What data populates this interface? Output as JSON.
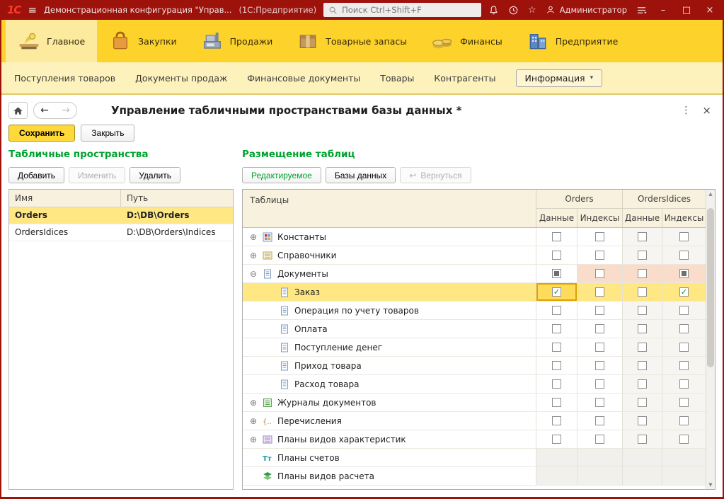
{
  "titlebar": {
    "logo": "1С",
    "title": "Демонстрационная конфигурация \"Управ...",
    "title_suffix": "(1С:Предприятие)",
    "search_placeholder": "Поиск Ctrl+Shift+F",
    "user": "Администратор"
  },
  "icons": {
    "menu": "≡",
    "favorites": "☆",
    "minimize": "–",
    "maximize": "□",
    "close": "×",
    "kebab": "⋮",
    "back": "←",
    "forward": "→",
    "dropdown": "▾",
    "expand": "⊕",
    "collapse": "⊖",
    "check": "✓",
    "return": "↩",
    "scroll_up": "▲",
    "scroll_down": "▼"
  },
  "ribbon": {
    "sections": [
      {
        "label": "Главное",
        "active": true
      },
      {
        "label": "Закупки",
        "active": false
      },
      {
        "label": "Продажи",
        "active": false
      },
      {
        "label": "Товарные запасы",
        "active": false
      },
      {
        "label": "Финансы",
        "active": false
      },
      {
        "label": "Предприятие",
        "active": false
      }
    ]
  },
  "subnav": {
    "links": [
      "Поступления товаров",
      "Документы продаж",
      "Финансовые документы",
      "Товары",
      "Контрагенты"
    ],
    "dropdown": "Информация"
  },
  "page": {
    "title": "Управление табличными пространствами базы данных *",
    "save": "Сохранить",
    "close": "Закрыть"
  },
  "left_panel": {
    "title": "Табличные пространства",
    "buttons": {
      "add": "Добавить",
      "edit": "Изменить",
      "remove": "Удалить"
    },
    "columns": {
      "name": "Имя",
      "path": "Путь"
    },
    "rows": [
      {
        "name": "Orders",
        "path": "D:\\DB\\Orders",
        "selected": true
      },
      {
        "name": "OrdersIdices",
        "path": "D:\\DB\\Orders\\Indices",
        "selected": false
      }
    ]
  },
  "right_panel": {
    "title": "Размещение таблиц",
    "buttons": [
      {
        "label": "Редактируемое",
        "state": "active"
      },
      {
        "label": "Базы данных",
        "state": "normal"
      },
      {
        "label": "Вернуться",
        "state": "disabled"
      }
    ],
    "table": {
      "first_col": "Таблицы",
      "groups": [
        {
          "label": "Orders",
          "cols": [
            "Данные",
            "Индексы"
          ]
        },
        {
          "label": "OrdersIdices",
          "cols": [
            "Данные",
            "Индексы"
          ]
        }
      ],
      "rows": [
        {
          "label": "Константы",
          "level": 0,
          "expander": "plus",
          "icon": "constants",
          "checks": [
            "empty",
            "empty",
            "empty",
            "empty"
          ]
        },
        {
          "label": "Справочники",
          "level": 0,
          "expander": "plus",
          "icon": "catalog",
          "checks": [
            "empty",
            "empty",
            "empty",
            "empty"
          ]
        },
        {
          "label": "Документы",
          "level": 0,
          "expander": "minus",
          "icon": "document",
          "checks": [
            "ind",
            "empty",
            "empty",
            "ind"
          ],
          "highlight": "pink"
        },
        {
          "label": "Заказ",
          "level": 1,
          "expander": "none",
          "icon": "doc",
          "checks": [
            "check-focus",
            "empty",
            "empty",
            "check"
          ],
          "selected": true
        },
        {
          "label": "Операция по учету товаров",
          "level": 1,
          "expander": "none",
          "icon": "doc",
          "checks": [
            "empty",
            "empty",
            "empty",
            "empty"
          ]
        },
        {
          "label": "Оплата",
          "level": 1,
          "expander": "none",
          "icon": "doc",
          "checks": [
            "empty",
            "empty",
            "empty",
            "empty"
          ]
        },
        {
          "label": "Поступление денег",
          "level": 1,
          "expander": "none",
          "icon": "doc",
          "checks": [
            "empty",
            "empty",
            "empty",
            "empty"
          ]
        },
        {
          "label": "Приход товара",
          "level": 1,
          "expander": "none",
          "icon": "doc",
          "checks": [
            "empty",
            "empty",
            "empty",
            "empty"
          ]
        },
        {
          "label": "Расход товара",
          "level": 1,
          "expander": "none",
          "icon": "doc",
          "checks": [
            "empty",
            "empty",
            "empty",
            "empty"
          ]
        },
        {
          "label": "Журналы документов",
          "level": 0,
          "expander": "plus",
          "icon": "journal",
          "checks": [
            "empty",
            "empty",
            "empty",
            "empty"
          ]
        },
        {
          "label": "Перечисления",
          "level": 0,
          "expander": "plus",
          "icon": "enum",
          "checks": [
            "empty",
            "empty",
            "empty",
            "empty"
          ]
        },
        {
          "label": "Планы видов характеристик",
          "level": 0,
          "expander": "plus",
          "icon": "plan",
          "checks": [
            "empty",
            "empty",
            "empty",
            "empty"
          ]
        },
        {
          "label": "Планы счетов",
          "level": 0,
          "expander": "none",
          "icon": "accounts",
          "checks": [
            "none",
            "none",
            "none",
            "none"
          ]
        },
        {
          "label": "Планы видов расчета",
          "level": 0,
          "expander": "none",
          "icon": "calc",
          "checks": [
            "none",
            "none",
            "none",
            "none"
          ]
        }
      ]
    }
  },
  "colors": {
    "titlebar": "#9d120b",
    "ribbon": "#fdd32b",
    "accent_green": "#00a32e",
    "selection_yellow": "#ffe784",
    "modified_pink": "#f9dcc9"
  }
}
